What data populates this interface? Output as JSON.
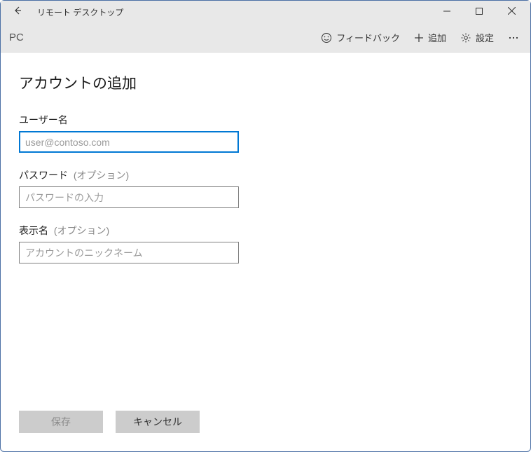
{
  "titlebar": {
    "app_title": "リモート デスクトップ"
  },
  "header": {
    "view_title": "PC",
    "feedback_label": "フィードバック",
    "add_label": "追加",
    "settings_label": "設定"
  },
  "form": {
    "page_title": "アカウントの追加",
    "username": {
      "label": "ユーザー名",
      "placeholder": "user@contoso.com",
      "value": ""
    },
    "password": {
      "label": "パスワード",
      "optional": "(オプション)",
      "placeholder": "パスワードの入力",
      "value": ""
    },
    "displayname": {
      "label": "表示名",
      "optional": "(オプション)",
      "placeholder": "アカウントのニックネーム",
      "value": ""
    }
  },
  "footer": {
    "save_label": "保存",
    "cancel_label": "キャンセル"
  }
}
